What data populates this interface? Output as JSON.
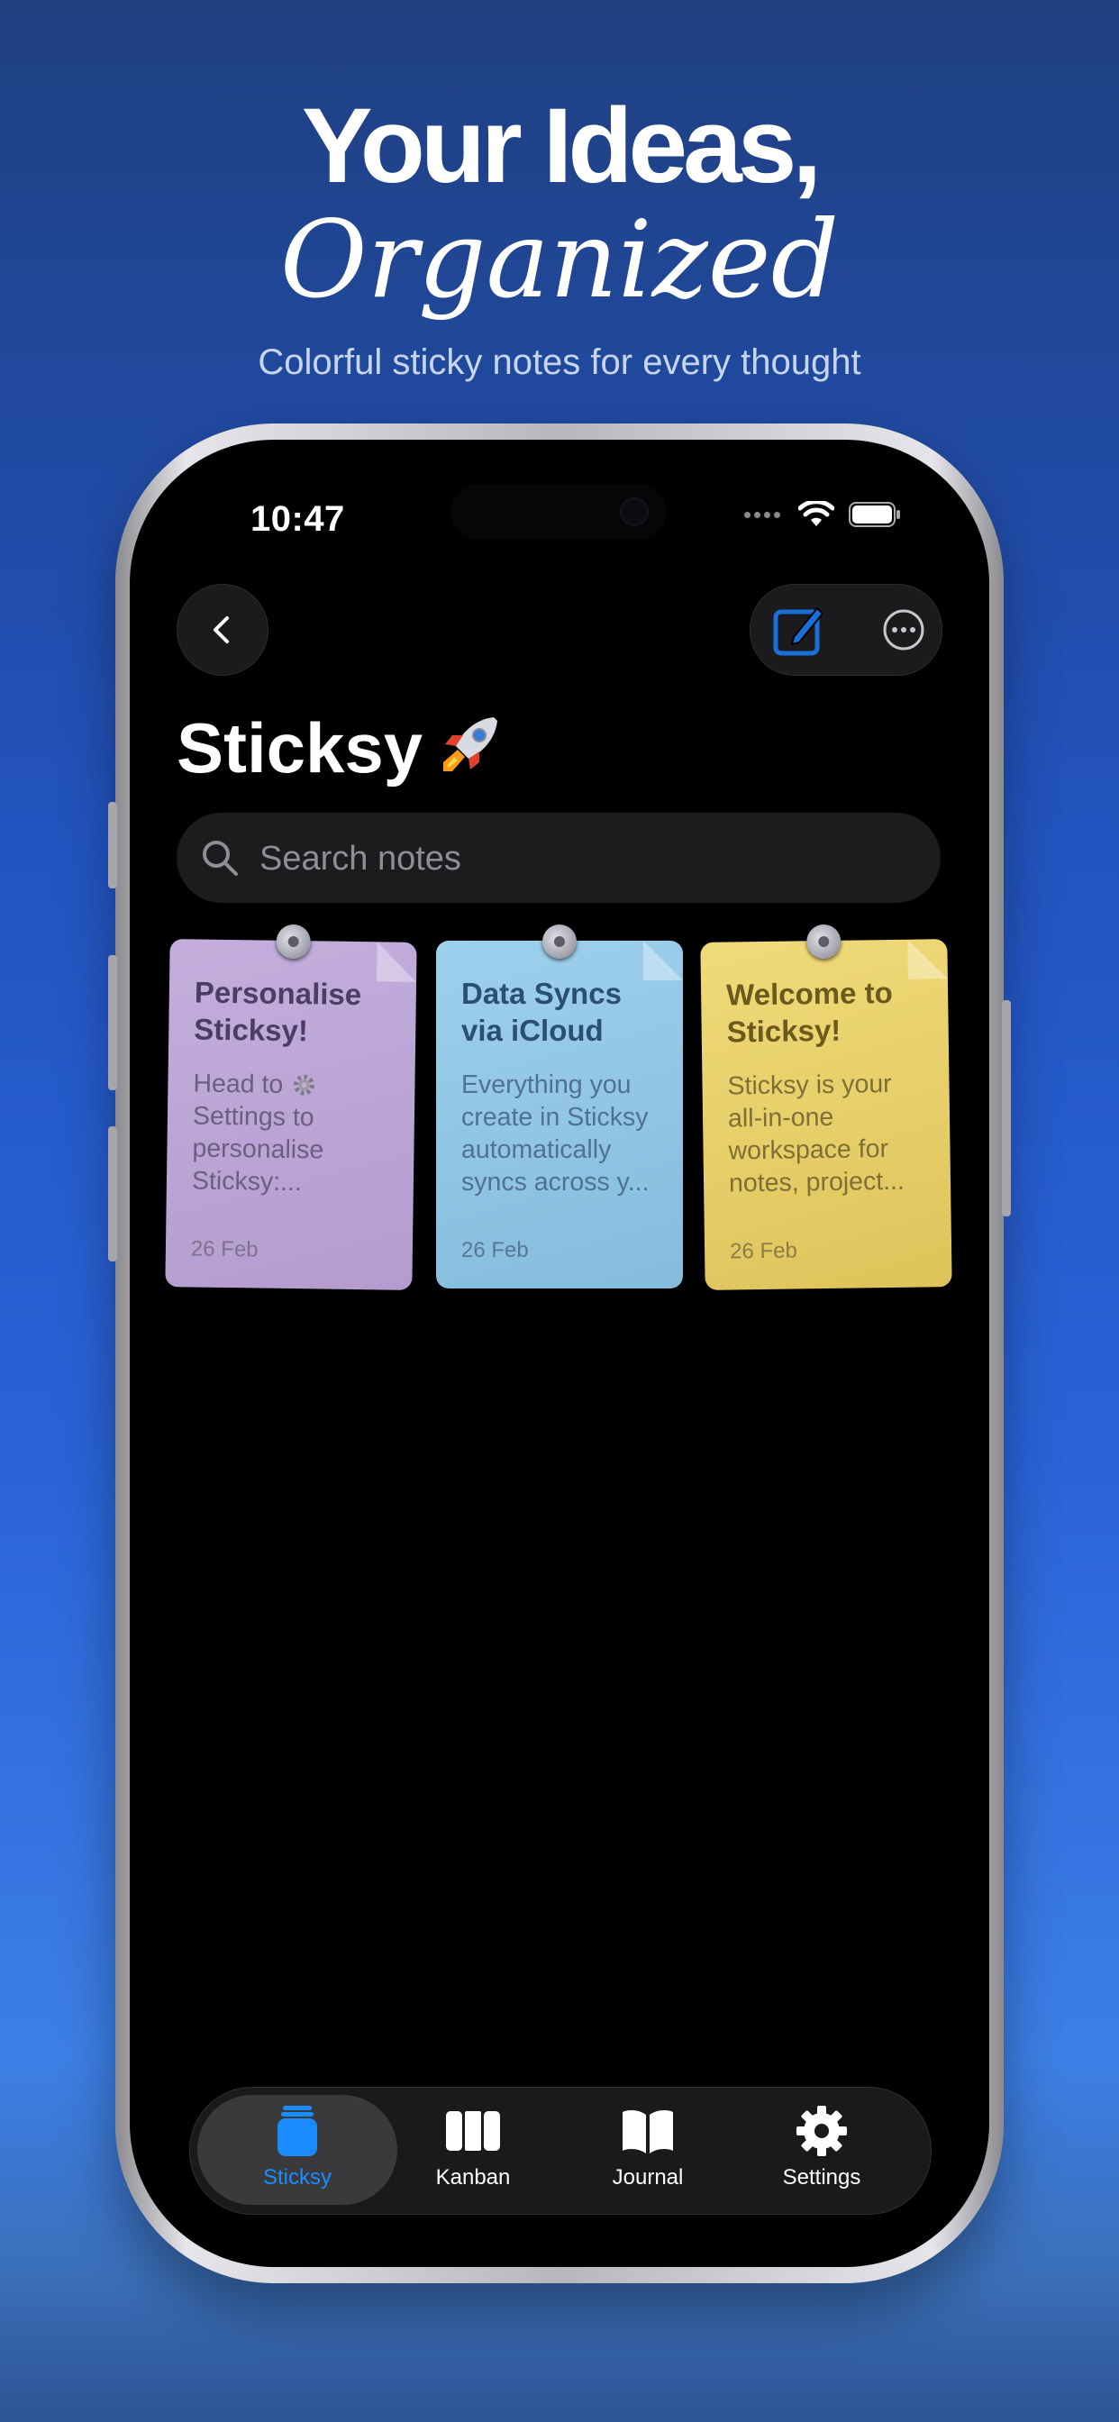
{
  "promo": {
    "headline_line1": "Your Ideas,",
    "headline_line2": "Organized",
    "subtitle": "Colorful sticky notes for every thought"
  },
  "status_bar": {
    "time": "10:47"
  },
  "toolbar": {
    "back_icon": "chevron-left-icon",
    "compose_icon": "compose-icon",
    "more_icon": "ellipsis-circle-icon"
  },
  "page": {
    "title": "Sticksy",
    "title_icon": "rocket-icon"
  },
  "search": {
    "placeholder": "Search notes",
    "value": ""
  },
  "notes": [
    {
      "title": "Personalise Sticksy!",
      "body_before_icon": "Head to",
      "body_icon": "gear-icon",
      "body": "Settings to personalise Sticksy:...",
      "date": "26 Feb",
      "color": "#b9a3d3"
    },
    {
      "title": "Data Syncs via iCloud",
      "body": "Everything you create in Sticksy automatically syncs across y...",
      "date": "26 Feb",
      "color": "#8fc4e2"
    },
    {
      "title": "Welcome to Sticksy!",
      "body": "Sticksy is your all-in-one workspace for notes, project...",
      "date": "26 Feb",
      "color": "#e8d06a"
    }
  ],
  "tabbar": {
    "active": "Sticksy",
    "items": [
      {
        "label": "Sticksy",
        "icon": "jar-icon"
      },
      {
        "label": "Kanban",
        "icon": "columns-icon"
      },
      {
        "label": "Journal",
        "icon": "book-icon"
      },
      {
        "label": "Settings",
        "icon": "gear-icon"
      }
    ]
  },
  "colors": {
    "accent": "#1a8cff",
    "background_top": "#1f3f80",
    "background_bottom": "#3d7fe6"
  }
}
